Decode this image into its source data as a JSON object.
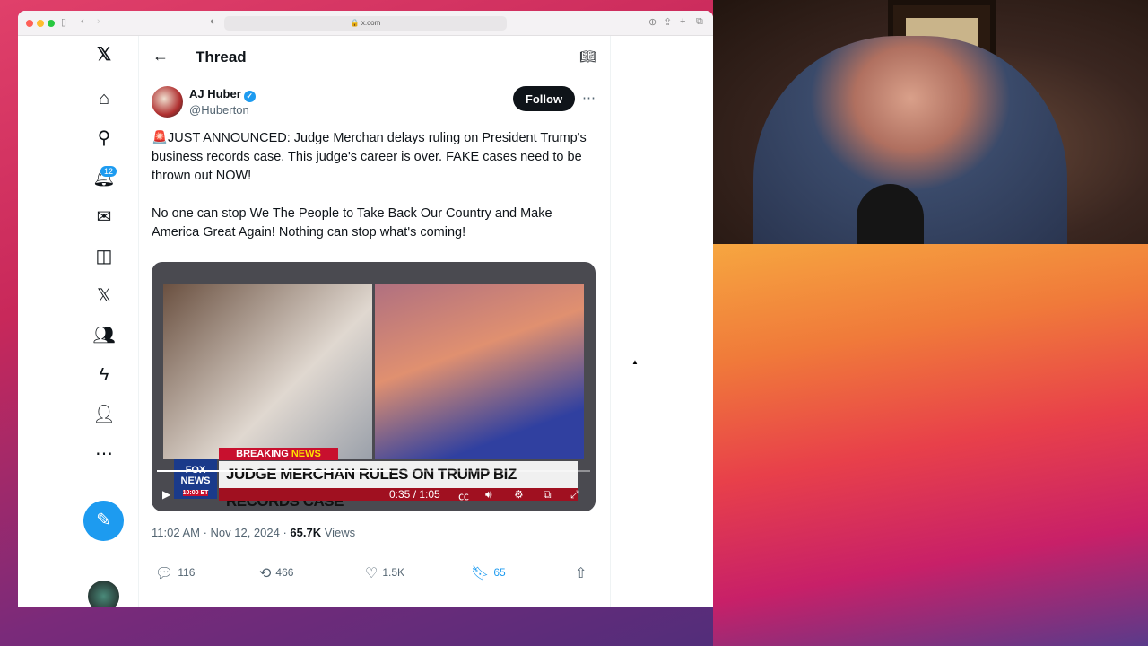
{
  "browser": {
    "url": "x.com"
  },
  "sidebar": {
    "notifications_badge": "12"
  },
  "header": {
    "title": "Thread"
  },
  "tweet": {
    "author": "AJ Huber",
    "handle": "@Huberton",
    "follow_label": "Follow",
    "text": "🚨JUST ANNOUNCED: Judge Merchan delays ruling on President Trump's business records case. This judge's career is over. FAKE cases need to be thrown out NOW!\n\nNo one can stop We The People to Take Back Our Country and Make America Great Again! Nothing can stop what's coming!",
    "video": {
      "breaking": "BREAKING",
      "news": "NEWS",
      "headline": "JUDGE MERCHAN RULES ON TRUMP BIZ RECORDS CASE",
      "logo": "FOX NEWS",
      "time_label": "10:00 ET",
      "time": "0:35 / 1:05",
      "progress": 0.54
    },
    "time": "11:02 AM · Nov 12, 2024 · ",
    "views": "65.7K",
    "views_label": " Views",
    "replies": "116",
    "reposts": "466",
    "likes": "1.5K",
    "bookmarks": "65"
  },
  "colors": {
    "accent": "#1d9bf0",
    "bookmark": "#1d9bf0"
  }
}
